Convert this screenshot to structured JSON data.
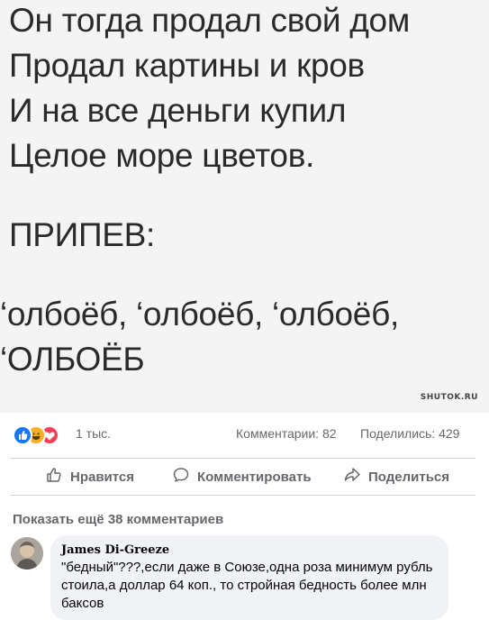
{
  "image": {
    "lines": [
      "Он тогда продал свой дом",
      "Продал картины и кров",
      "И на все деньги купил",
      "Целое море цветов.",
      "ПРИПЕВ:",
      "‘олбоёб, ‘олбоёб, ‘олбоёб,",
      "‘ОЛБОЁБ"
    ],
    "watermark": "SHUTOK.RU"
  },
  "stats": {
    "reactions_count": "1 тыс.",
    "comments": "Комментарии: 82",
    "shares": "Поделились: 429"
  },
  "actions": {
    "like": "Нравится",
    "comment": "Комментировать",
    "share": "Поделиться"
  },
  "more_comments": "Показать ещё 38 комментариев",
  "comment": {
    "author": "James Di-Greeze",
    "text": "\"бедный\"???,если даже в Союзе,одна роза минимум рубль стоила,а доллар 64 коп., то стройная бедность более млн баксов"
  },
  "colors": {
    "like_blue": "#1877f2",
    "haha_yellow": "#f7b125",
    "love_red": "#f33e58",
    "muted_text": "#65676b"
  }
}
